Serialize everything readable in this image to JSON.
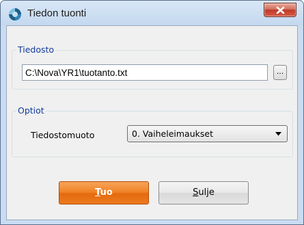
{
  "window": {
    "title": "Tiedon tuonti",
    "close_label": "x"
  },
  "file_group": {
    "legend": "Tiedosto",
    "path_value": "C:\\Nova\\YR1\\tuotanto.txt",
    "browse_label": "..."
  },
  "options_group": {
    "legend": "Optiot",
    "format_label": "Tiedostomuoto",
    "format_selected": "0. Vaiheleimaukset"
  },
  "buttons": {
    "import_mnemonic": "T",
    "import_rest": "uo",
    "close_mnemonic": "S",
    "close_rest": "ulje"
  },
  "colors": {
    "legend": "#123a9c",
    "primary_button": "#f08428",
    "close_button": "#c0392a"
  },
  "icons": {
    "app": "app-logo-icon",
    "close": "close-icon",
    "dropdown": "chevron-down-icon"
  }
}
